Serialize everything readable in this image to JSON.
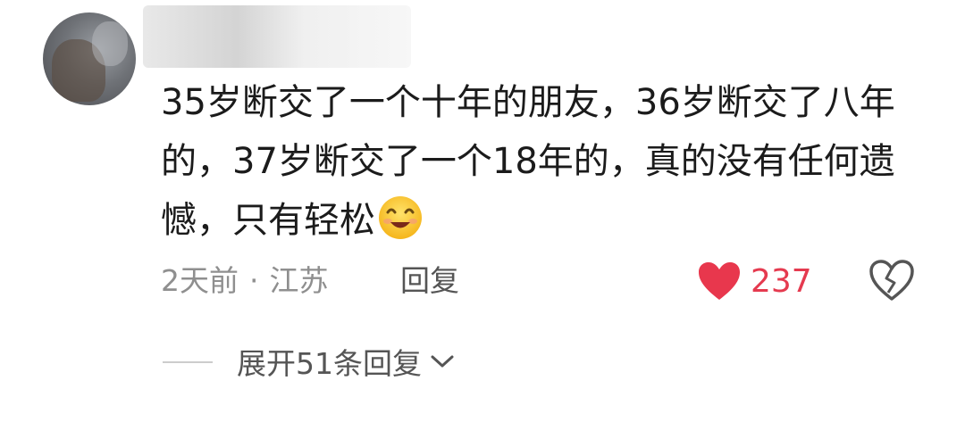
{
  "comment": {
    "text": "35岁断交了一个十年的朋友，36岁断交了八年的，37岁断交了一个18年的，真的没有任何遗憾，只有轻松",
    "emoji_icon": "smiling-face-icon"
  },
  "meta": {
    "time": "2天前",
    "separator": "·",
    "location": "江苏",
    "reply_label": "回复"
  },
  "like": {
    "count": "237",
    "color": "#e8374d",
    "icon": "heart-icon"
  },
  "dislike": {
    "icon": "broken-heart-icon"
  },
  "expand": {
    "label": "展开51条回复",
    "icon": "chevron-down-icon"
  }
}
